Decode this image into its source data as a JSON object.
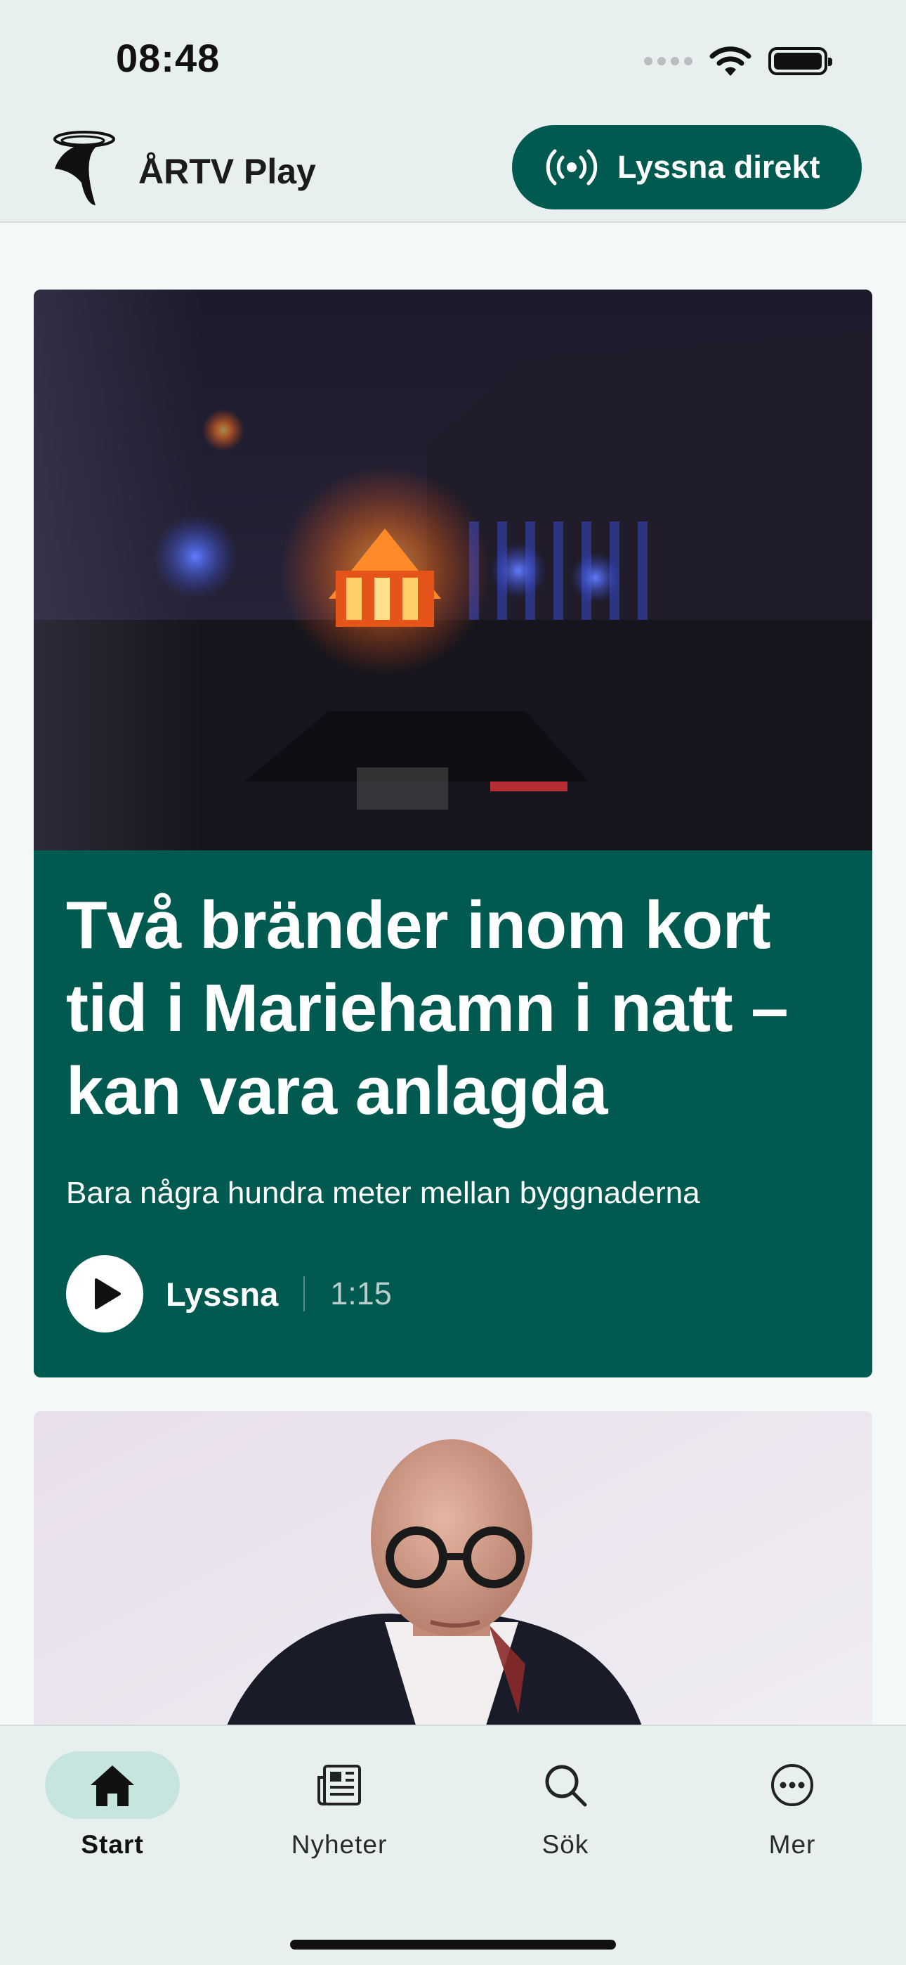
{
  "status_bar": {
    "time": "08:48"
  },
  "header": {
    "brand": "ÅRTV Play",
    "listen_live_label": "Lyssna direkt"
  },
  "feature_card": {
    "headline": "Två bränder inom kort tid i Mariehamn i natt – kan vara anlagda",
    "subline": "Bara några hundra meter mellan byggnaderna",
    "listen_label": "Lyssna",
    "duration": "1:15"
  },
  "tabs": [
    {
      "label": "Start",
      "icon": "home-icon",
      "active": true
    },
    {
      "label": "Nyheter",
      "icon": "newspaper-icon",
      "active": false
    },
    {
      "label": "Sök",
      "icon": "search-icon",
      "active": false
    },
    {
      "label": "Mer",
      "icon": "more-icon",
      "active": false
    }
  ],
  "colors": {
    "brand_green": "#005a50",
    "active_tab_pill": "#c7e5df",
    "topbar_bg": "#e8f0ef"
  }
}
